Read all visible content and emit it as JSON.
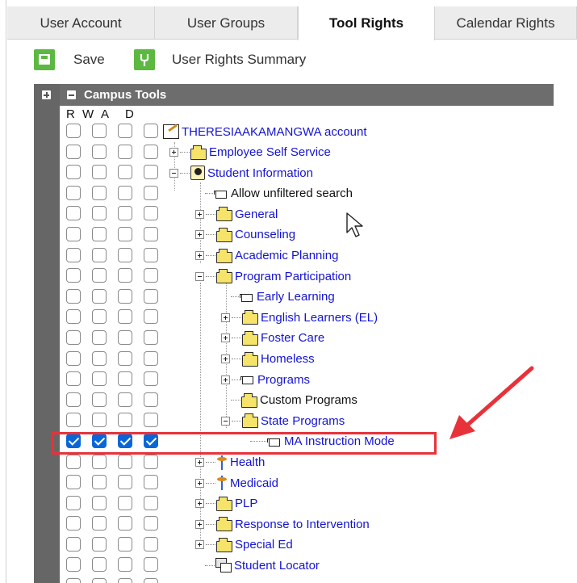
{
  "tabs": [
    {
      "label": "User Account",
      "active": false
    },
    {
      "label": "User Groups",
      "active": false
    },
    {
      "label": "Tool Rights",
      "active": true
    },
    {
      "label": "Calendar Rights",
      "active": false
    }
  ],
  "toolbar": {
    "save_label": "Save",
    "summary_label": "User Rights Summary",
    "icon_color": "#5cb841"
  },
  "panel": {
    "title": "Campus Tools",
    "columns": [
      "R",
      "W",
      "A",
      "D"
    ]
  },
  "tree": [
    {
      "label": "THERESIAAKAMANGWA account",
      "icon": "account-icon",
      "checked": false
    },
    {
      "label": "Employee Self Service",
      "icon": "folder-icon",
      "checked": false
    },
    {
      "label": "Student Information",
      "icon": "student-icon",
      "checked": false
    },
    {
      "label": "Allow unfiltered search",
      "icon": "page-icon",
      "checked": false
    },
    {
      "label": "General",
      "icon": "folder-icon",
      "checked": false
    },
    {
      "label": "Counseling",
      "icon": "folder-icon",
      "checked": false
    },
    {
      "label": "Academic Planning",
      "icon": "folder-icon",
      "checked": false
    },
    {
      "label": "Program Participation",
      "icon": "folder-icon",
      "checked": false
    },
    {
      "label": "Early Learning",
      "icon": "page-icon",
      "checked": false
    },
    {
      "label": "English Learners (EL)",
      "icon": "folder-icon",
      "checked": false
    },
    {
      "label": "Foster Care",
      "icon": "folder-icon",
      "checked": false
    },
    {
      "label": "Homeless",
      "icon": "folder-icon",
      "checked": false
    },
    {
      "label": "Programs",
      "icon": "page-icon",
      "checked": false
    },
    {
      "label": "Custom Programs",
      "icon": "folder-icon",
      "checked": false
    },
    {
      "label": "State Programs",
      "icon": "folder-icon",
      "checked": false
    },
    {
      "label": "MA Instruction Mode",
      "icon": "page-icon",
      "checked": true
    },
    {
      "label": "Health",
      "icon": "caduceus-icon",
      "checked": false
    },
    {
      "label": "Medicaid",
      "icon": "caduceus-icon",
      "checked": false
    },
    {
      "label": "PLP",
      "icon": "folder-icon",
      "checked": false
    },
    {
      "label": "Response to Intervention",
      "icon": "folder-icon",
      "checked": false
    },
    {
      "label": "Special Ed",
      "icon": "folder-icon",
      "checked": false
    },
    {
      "label": "Student Locator",
      "icon": "locator-icon",
      "checked": false
    }
  ],
  "colors": {
    "link": "#1414d2",
    "checkbox_checked": "#0a66d8",
    "highlight": "#e8323a",
    "header_bg": "#6d6d6d"
  }
}
